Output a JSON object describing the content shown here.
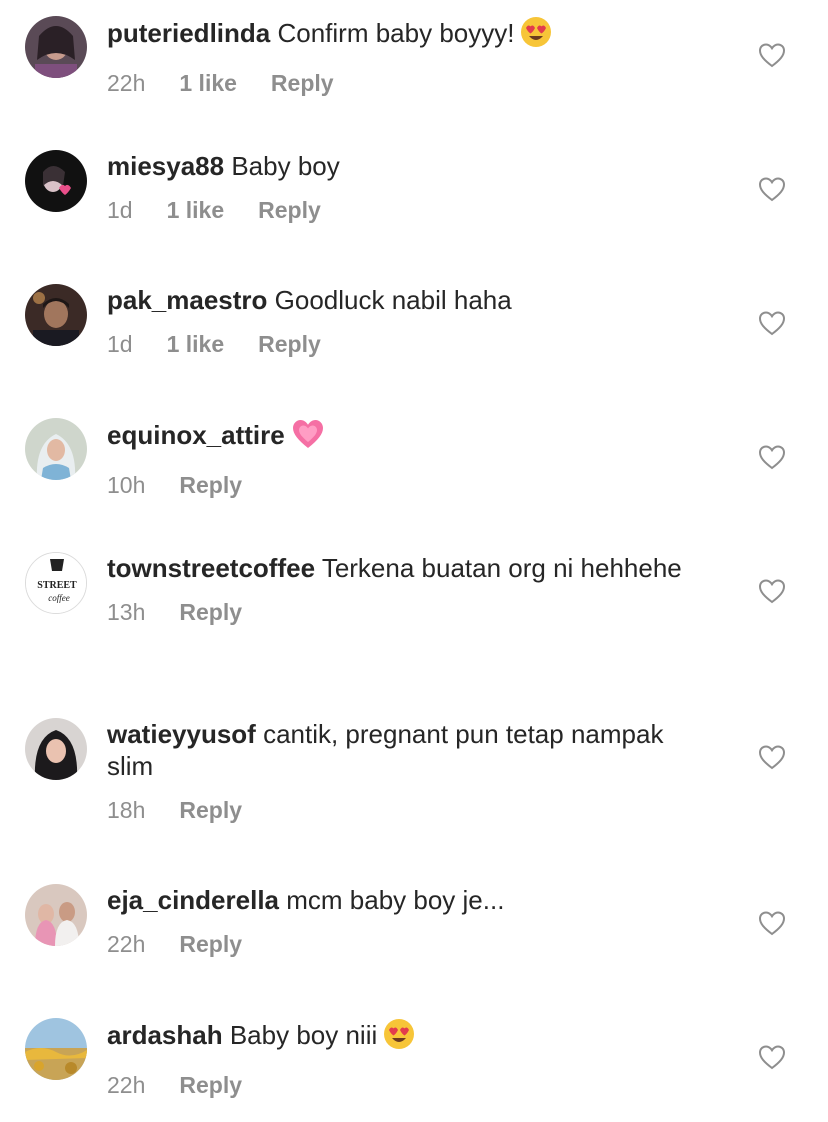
{
  "comments": [
    {
      "username": "puteriedlinda",
      "text": "Confirm baby boyyy!",
      "emoji": "heart-eyes-emoji",
      "time": "22h",
      "likes": "1 like",
      "reply": "Reply"
    },
    {
      "username": "miesya88",
      "text": "Baby boy",
      "emoji": "",
      "time": "1d",
      "likes": "1 like",
      "reply": "Reply"
    },
    {
      "username": "pak_maestro",
      "text": "Goodluck nabil haha",
      "emoji": "",
      "time": "1d",
      "likes": "1 like",
      "reply": "Reply"
    },
    {
      "username": "equinox_attire",
      "text": "",
      "emoji": "growing-heart-emoji",
      "time": "10h",
      "likes": "",
      "reply": "Reply"
    },
    {
      "username": "townstreetcoffee",
      "text": "Terkena buatan org ni hehhehe",
      "emoji": "",
      "time": "13h",
      "likes": "",
      "reply": "Reply"
    },
    {
      "username": "watieyyusof",
      "text": "cantik, pregnant pun tetap nampak slim",
      "emoji": "",
      "time": "18h",
      "likes": "",
      "reply": "Reply"
    },
    {
      "username": "eja_cinderella",
      "text": "mcm baby boy je...",
      "emoji": "",
      "time": "22h",
      "likes": "",
      "reply": "Reply"
    },
    {
      "username": "ardashah",
      "text": "Baby boy niii",
      "emoji": "heart-eyes-emoji",
      "time": "22h",
      "likes": "",
      "reply": "Reply"
    }
  ],
  "icons": {
    "like": "heart-outline-icon"
  },
  "colors": {
    "text": "#262626",
    "meta": "#8e8e8e",
    "heart_outline": "#8e8e8e",
    "background": "#ffffff"
  },
  "avatar_store": {
    "townstreetcoffee_top": "STREET",
    "townstreetcoffee_bottom": "coffee"
  }
}
